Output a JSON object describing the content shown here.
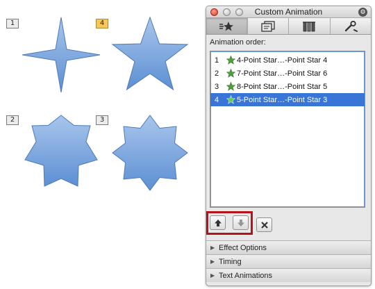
{
  "slide": {
    "tags": [
      {
        "label": "1",
        "active": false
      },
      {
        "label": "4",
        "active": true
      },
      {
        "label": "2",
        "active": false
      },
      {
        "label": "3",
        "active": false
      }
    ]
  },
  "palette": {
    "title": "Custom Animation",
    "tabs": [
      "animation-effects-icon",
      "transitions-icon",
      "backgrounds-icon",
      "tools-icon"
    ],
    "order_label": "Animation order:",
    "order_items": [
      {
        "index": "1",
        "text": "4-Point Star…-Point Star 4",
        "selected": false
      },
      {
        "index": "2",
        "text": "7-Point Star…-Point Star 6",
        "selected": false
      },
      {
        "index": "3",
        "text": "8-Point Star…-Point Star 5",
        "selected": false
      },
      {
        "index": "4",
        "text": "5-Point Star…-Point Star 3",
        "selected": true
      }
    ],
    "sections": [
      "Effect Options",
      "Timing",
      "Text Animations"
    ]
  },
  "colors": {
    "star_fill_top": "#a9c6ec",
    "star_fill_bottom": "#5c8fd3",
    "selection": "#3875d7",
    "highlight_border": "#b5121b",
    "active_tag": "#f8c757"
  }
}
